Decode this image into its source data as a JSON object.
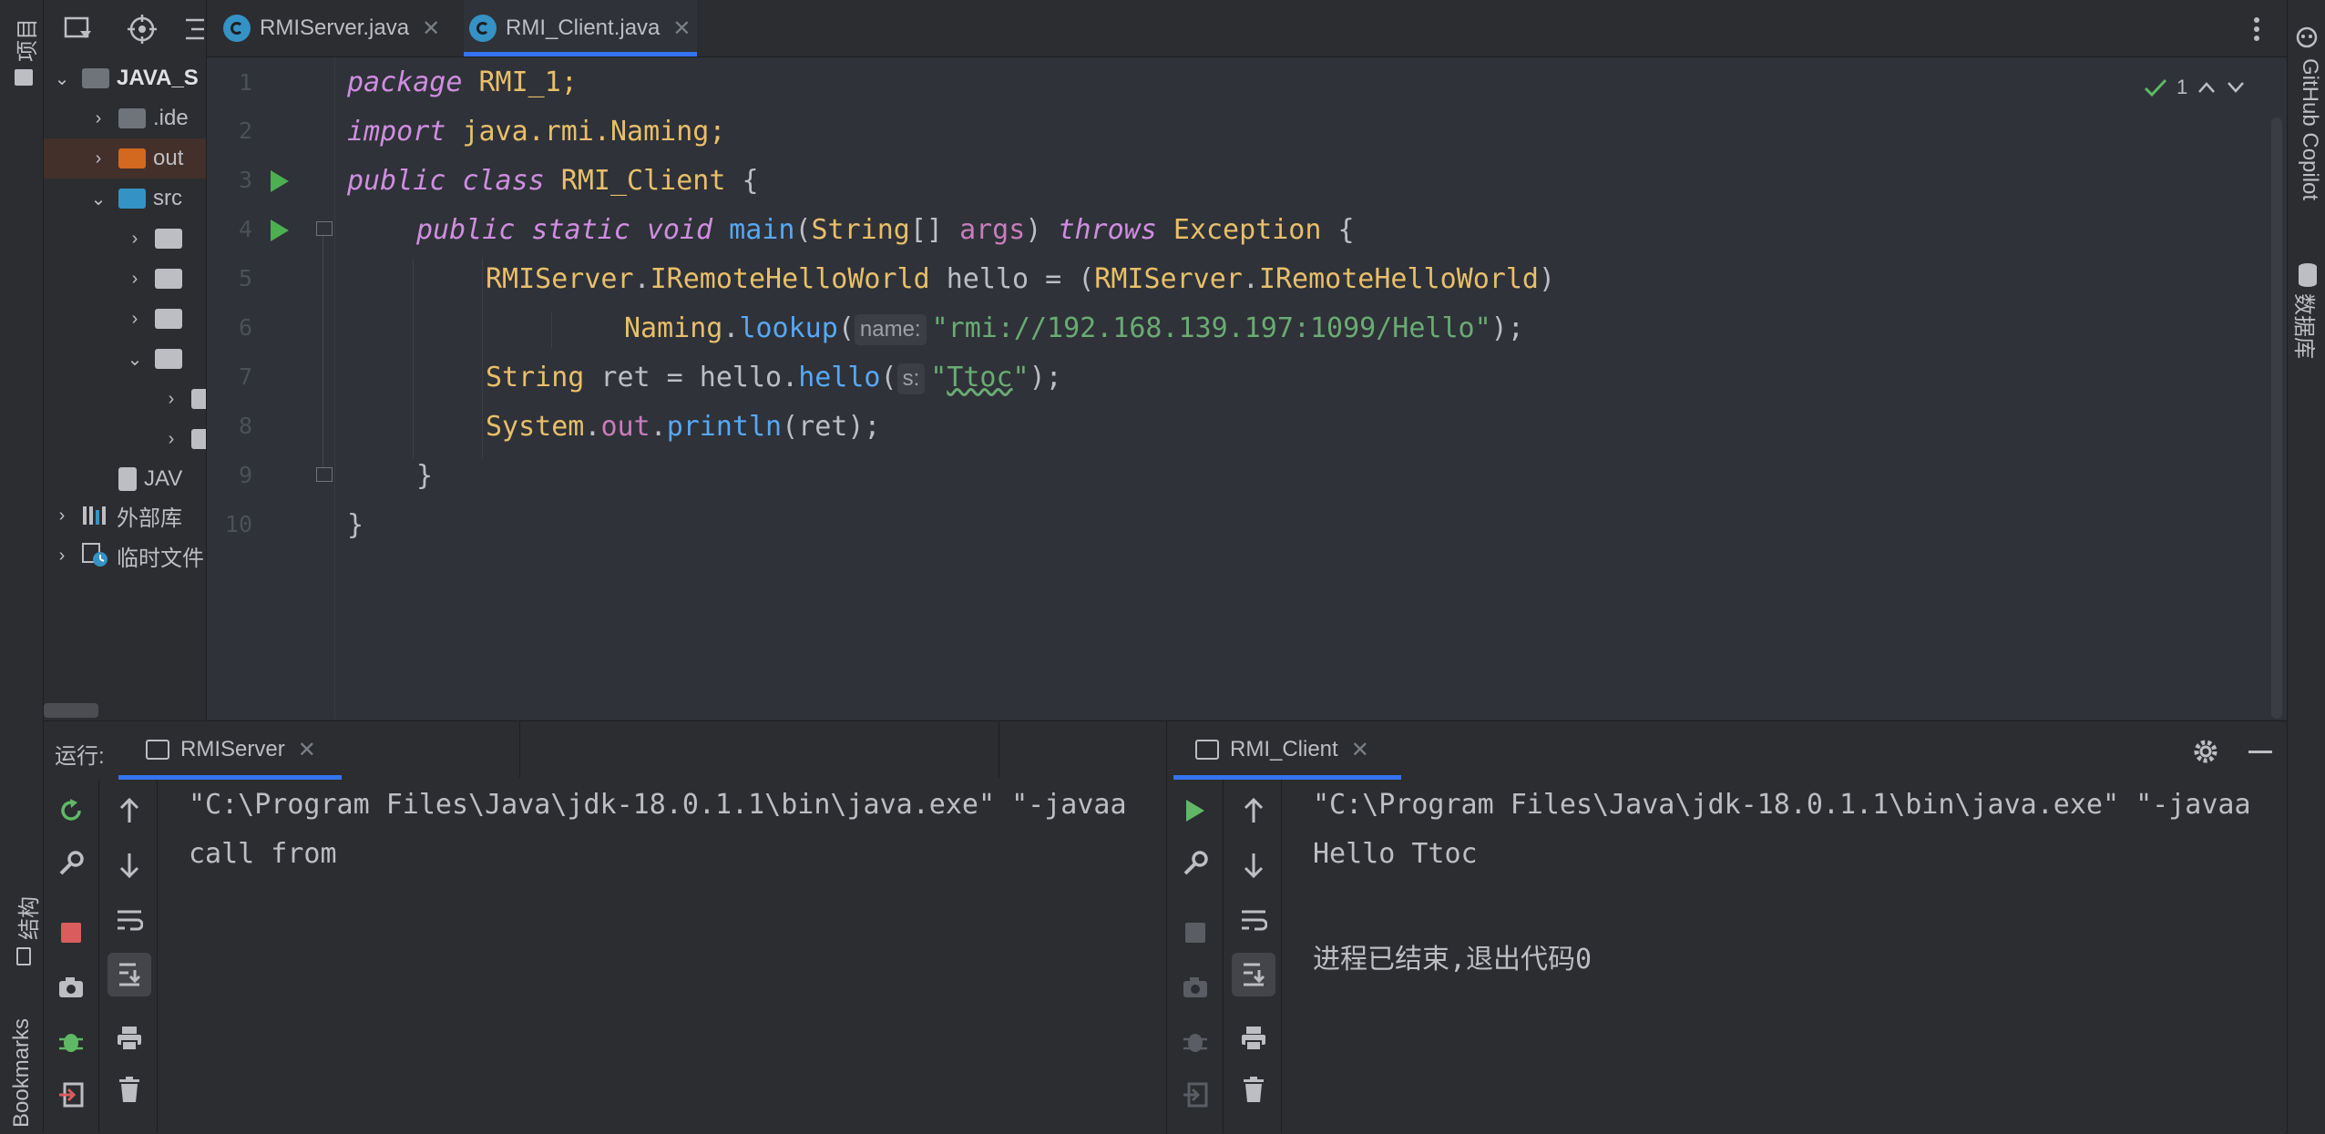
{
  "left_stripe": {
    "project_label": "项目",
    "structure_label": "结构",
    "bookmarks_label": "Bookmarks"
  },
  "right_stripe": {
    "copilot_label": "GitHub Copilot",
    "database_label": "数据库"
  },
  "project_tree": {
    "root": "JAVA_S",
    "items": [
      {
        "label": ".ide",
        "depth": 1,
        "expanded": false,
        "color": "#6f737a"
      },
      {
        "label": "out",
        "depth": 1,
        "expanded": false,
        "color": "#d2691e",
        "selected": true
      },
      {
        "label": "src",
        "depth": 1,
        "expanded": true,
        "color": "#3592c4"
      },
      {
        "label": "",
        "depth": 2,
        "expanded": false,
        "color": "#bcbec4"
      },
      {
        "label": "",
        "depth": 2,
        "expanded": false,
        "color": "#bcbec4"
      },
      {
        "label": "",
        "depth": 2,
        "expanded": false,
        "color": "#bcbec4"
      },
      {
        "label": "",
        "depth": 2,
        "expanded": true,
        "color": "#bcbec4"
      },
      {
        "label": "",
        "depth": 3,
        "expanded": false,
        "color": "#bcbec4"
      },
      {
        "label": "",
        "depth": 3,
        "expanded": false,
        "color": "#bcbec4"
      },
      {
        "label": "JAV",
        "depth": 1,
        "expanded": false,
        "color": "#bcbec4"
      }
    ],
    "external_libs": "外部库",
    "scratches": "临时文件"
  },
  "tabs": [
    {
      "label": "RMIServer.java",
      "active": false
    },
    {
      "label": "RMI_Client.java",
      "active": true
    }
  ],
  "editor": {
    "line_numbers": [
      "1",
      "2",
      "3",
      "4",
      "5",
      "6",
      "7",
      "8",
      "9",
      "10"
    ],
    "inspection_count": "1",
    "hint_name": "name:",
    "hint_s": "s:",
    "lines": {
      "l1_kw": "package",
      "l1_rest": " RMI_1;",
      "l2_kw": "import",
      "l2_rest": " java.rmi.Naming;",
      "l3_kw1": "public",
      "l3_kw2": " class",
      "l3_cls": " RMI_Client",
      "l3_rest": " {",
      "l4_kw1": "public",
      "l4_kw2": " static",
      "l4_kw3": " void",
      "l4_fn": " main",
      "l4_p1": "(",
      "l4_cls": "String",
      "l4_p2": "[] ",
      "l4_par": "args",
      "l4_p3": ") ",
      "l4_kw4": "throws",
      "l4_cls2": " Exception",
      "l4_p4": " {",
      "l5_cls1": "RMIServer",
      "l5_p1": ".",
      "l5_cls2": "IRemoteHelloWorld",
      "l5_p2": " hello = (",
      "l5_cls3": "RMIServer",
      "l5_p3": ".",
      "l5_cls4": "IRemoteHelloWorld",
      "l5_p4": ")",
      "l6_cls": "Naming",
      "l6_p1": ".",
      "l6_fn": "lookup",
      "l6_p2": "(",
      "l6_str": "\"rmi://192.168.139.197:1099/Hello\"",
      "l6_p3": ");",
      "l7_cls": "String",
      "l7_p1": " ret = hello.",
      "l7_fn": "hello",
      "l7_p2": "(",
      "l7_str1": "\"",
      "l7_str2": "Ttoc",
      "l7_str3": "\"",
      "l7_p3": ");",
      "l8_cls": "System",
      "l8_p1": ".",
      "l8_fld": "out",
      "l8_p2": ".",
      "l8_fn": "println",
      "l8_p3": "(ret);",
      "l9": "}",
      "l10": "}"
    }
  },
  "run_panel": {
    "run_label": "运行:",
    "left_tab": "RMIServer",
    "right_tab": "RMI_Client",
    "left_console": [
      "\"C:\\Program Files\\Java\\jdk-18.0.1.1\\bin\\java.exe\" \"-javaa",
      "call from"
    ],
    "right_console": [
      "\"C:\\Program Files\\Java\\jdk-18.0.1.1\\bin\\java.exe\" \"-javaa",
      "Hello Ttoc",
      "",
      "进程已结束,退出代码0"
    ]
  },
  "colors": {
    "accent": "#3574f0",
    "run_green": "#4caf50",
    "stop_red": "#db5c5c"
  }
}
